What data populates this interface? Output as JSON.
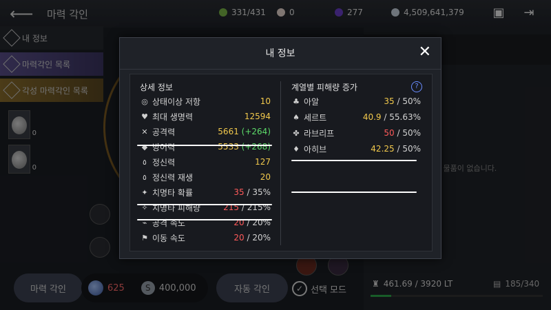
{
  "header": {
    "title": "마력 각인",
    "currencies": [
      {
        "icon": "green-energy-icon",
        "value": "331/431",
        "color": "#7ab648"
      },
      {
        "icon": "pearl-icon",
        "value": "0",
        "color": "#e8d8d0"
      },
      {
        "icon": "purple-orb-icon",
        "value": "277",
        "color": "#6a3fc8"
      },
      {
        "icon": "silver-coin-icon",
        "value": "4,509,641,379",
        "color": "#c8d4e0"
      }
    ]
  },
  "sidebar": {
    "items": [
      {
        "label": "내 정보"
      },
      {
        "label": "마력각인 목록"
      },
      {
        "label": "각성 마력각인 목록"
      }
    ],
    "slot_counts": [
      "0",
      "0"
    ]
  },
  "background": {
    "empty_message": "보유한 인 물품이 없습니다."
  },
  "bottom": {
    "engrave_label": "마력 각인",
    "gem_cost": "625",
    "silver_cost": "400,000",
    "auto_label": "자동 각인",
    "select_mode_label": "선택 모드",
    "weight": "461.69 / 3920 LT",
    "slots": "185/340",
    "weight_fill": 0.118
  },
  "modal": {
    "title": "내 정보",
    "left_title": "상세 정보",
    "right_title": "계열별 피해량 증가",
    "stats": [
      {
        "icon": "status-resist-icon",
        "label": "상태이상 저항",
        "value": "10",
        "bonus": "",
        "max": "",
        "color": "yellow"
      },
      {
        "icon": "heart-icon",
        "label": "최대 생명력",
        "value": "12594",
        "bonus": "",
        "max": "",
        "color": "yellow"
      },
      {
        "icon": "swords-icon",
        "label": "공격력",
        "value": "5661",
        "bonus": "(+264)",
        "max": "",
        "color": "yellow"
      },
      {
        "icon": "shield-icon",
        "label": "방어력",
        "value": "5533",
        "bonus": "(+268)",
        "max": "",
        "color": "yellow"
      },
      {
        "icon": "spirit-icon",
        "label": "정신력",
        "value": "127",
        "bonus": "",
        "max": "",
        "color": "yellow"
      },
      {
        "icon": "spirit-regen-icon",
        "label": "정신력 재생",
        "value": "20",
        "bonus": "",
        "max": "",
        "color": "yellow"
      },
      {
        "icon": "crit-chance-icon",
        "label": "치명타 확률",
        "value": "35",
        "bonus": "",
        "max": "35%",
        "color": "red"
      },
      {
        "icon": "crit-damage-icon",
        "label": "치명타 피해량",
        "value": "215",
        "bonus": "",
        "max": "215%",
        "color": "red"
      },
      {
        "icon": "attack-speed-icon",
        "label": "공격 속도",
        "value": "20",
        "bonus": "",
        "max": "20%",
        "color": "red"
      },
      {
        "icon": "move-speed-icon",
        "label": "이동 속도",
        "value": "20",
        "bonus": "",
        "max": "20%",
        "color": "red"
      }
    ],
    "resistances": [
      {
        "icon": "arall-icon",
        "label": "아알",
        "value": "35",
        "max": "50%",
        "color": "yellow"
      },
      {
        "icon": "sert-icon",
        "label": "세르트",
        "value": "40.9",
        "max": "55.63%",
        "color": "yellow"
      },
      {
        "icon": "labriff-icon",
        "label": "라브리프",
        "value": "50",
        "max": "50%",
        "color": "red"
      },
      {
        "icon": "ahiv-icon",
        "label": "아히브",
        "value": "42.25",
        "max": "50%",
        "color": "yellow"
      }
    ]
  }
}
